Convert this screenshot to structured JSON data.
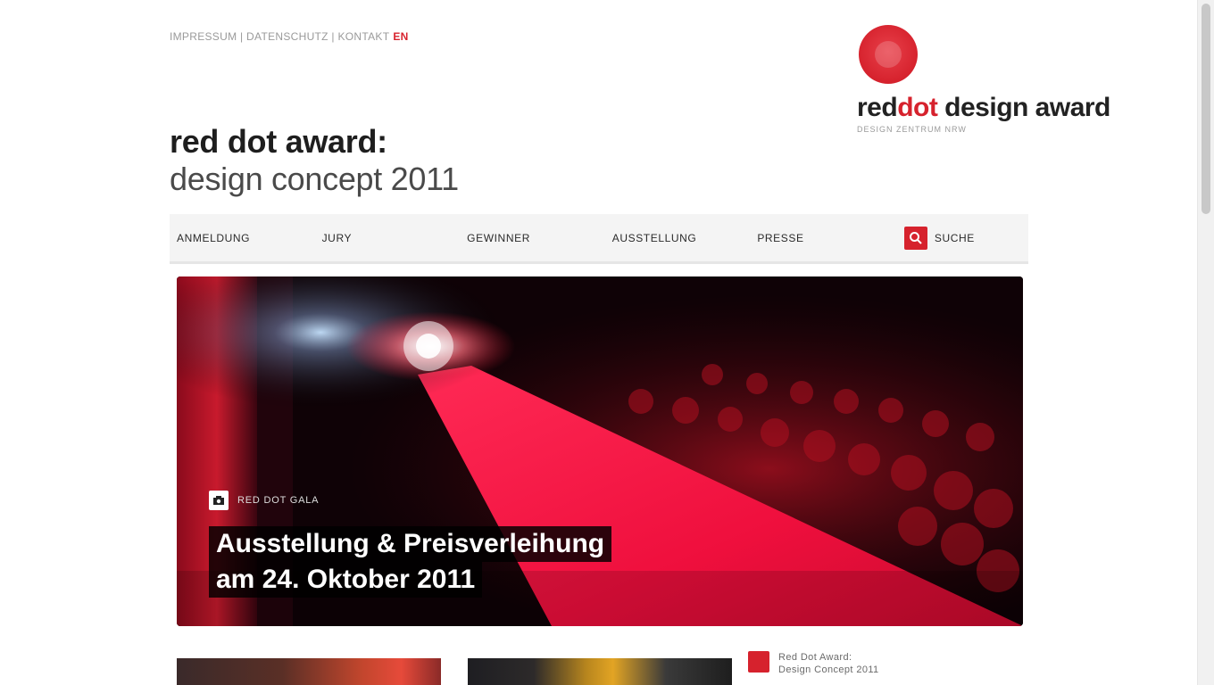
{
  "top_bar": {
    "links_text": "IMPRESSUM | DATENSCHUTZ | KONTAKT",
    "lang_label": "EN"
  },
  "logo": {
    "text_main": "red",
    "text_accent": "dot",
    "text_suffix": " design award",
    "subtitle": "DESIGN ZENTRUM NRW"
  },
  "header": {
    "title_line1": "red dot award:",
    "title_line2": "design concept 2011"
  },
  "nav": {
    "items": [
      {
        "label": "Anmeldung"
      },
      {
        "label": "Jury"
      },
      {
        "label": "Gewinner"
      },
      {
        "label": "Ausstellung"
      },
      {
        "label": "Presse"
      }
    ],
    "search_label": "Suche"
  },
  "hero": {
    "tag_label": "Red Dot Gala",
    "title_line1": "Ausstellung & Preisverleihung",
    "title_line2": "am 24. Oktober 2011"
  },
  "side_news": {
    "label_line1": "Red Dot Award:",
    "label_line2": "Design Concept 2011"
  },
  "colors": {
    "brand_red": "#d6222d",
    "nav_bg": "#f4f4f4"
  },
  "icons": {
    "logo": "red-dot-icon",
    "search": "search-icon",
    "hero_tag": "camera-icon",
    "side_news": "news-icon"
  }
}
